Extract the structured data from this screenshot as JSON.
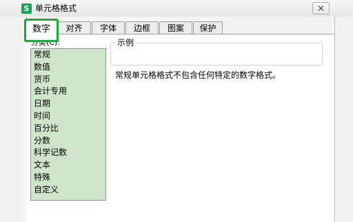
{
  "window": {
    "icon_letter": "S",
    "title": "单元格格式"
  },
  "tabs": [
    {
      "label": "数字",
      "active": true
    },
    {
      "label": "对齐"
    },
    {
      "label": "字体"
    },
    {
      "label": "边框"
    },
    {
      "label": "图案"
    },
    {
      "label": "保护"
    }
  ],
  "category": {
    "label": "分类(C):",
    "items": [
      "常规",
      "数值",
      "货币",
      "会计专用",
      "日期",
      "时间",
      "百分比",
      "分数",
      "科学记数",
      "文本",
      "特殊",
      "自定义"
    ],
    "selected": "常规"
  },
  "preview": {
    "label": "示例",
    "value": ""
  },
  "description": "常规单元格格式不包含任何特定的数字格式。",
  "colors": {
    "active_tab_border": "#1da83b",
    "list_background": "#cfe6cb",
    "app_icon": "#19a25a"
  }
}
